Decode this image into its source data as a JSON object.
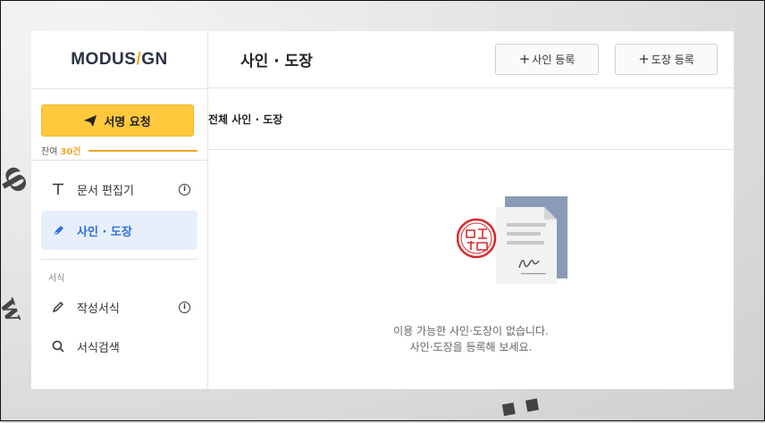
{
  "logo": {
    "text_a": "MODUS",
    "text_slash": "/",
    "text_b": "GN"
  },
  "sidebar": {
    "sign_request_label": "서명 요청",
    "remaining_label": "잔여",
    "remaining_count": "30건",
    "items": [
      {
        "label": "문서 편집기",
        "icon": "text-t-icon",
        "has_info": true
      },
      {
        "label": "사인 · 도장",
        "icon": "pen-nib-icon",
        "active": true
      },
      {
        "label": "작성서식",
        "icon": "pencil-icon",
        "has_info": true
      },
      {
        "label": "서식검색",
        "icon": "search-icon"
      }
    ],
    "section_label": "서식"
  },
  "header": {
    "title": "사인 · 도장",
    "add_signature_label": "사인 등록",
    "add_stamp_label": "도장 등록"
  },
  "subheader": {
    "label": "전체 사인 · 도장"
  },
  "empty": {
    "line1": "이용 가능한 사인·도장이 없습니다.",
    "line2": "사인·도장을 등록해 보세요."
  },
  "colors": {
    "accent_yellow": "#ffc83d",
    "accent_blue": "#2e6fe0",
    "logo_slash": "#f5a623"
  }
}
